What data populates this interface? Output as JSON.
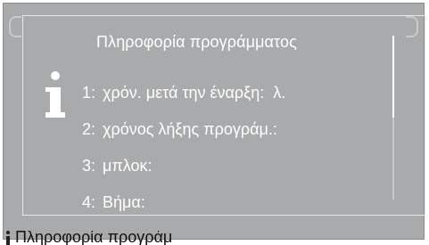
{
  "dialog": {
    "title": "Πληροφορία προγράμματος",
    "items": [
      {
        "num": "1:",
        "label": "χρόν. μετά την έναρξη:",
        "value": "λ."
      },
      {
        "num": "2:",
        "label": "χρόνος λήξης προγράμ.:",
        "value": ""
      },
      {
        "num": "3:",
        "label": "μπλοκ:",
        "value": ""
      },
      {
        "num": "4:",
        "label": "Βήμα:",
        "value": ""
      }
    ]
  },
  "footer": {
    "label": "Πληροφορία προγράμ"
  },
  "scroll": {
    "visible_fraction": 0.5,
    "position_fraction": 0.0
  },
  "colors": {
    "screen_bg": "#a9aaab",
    "text": "#ffffff",
    "dialog_border": "#e8e8e8"
  },
  "icons": {
    "info": "info-icon"
  }
}
